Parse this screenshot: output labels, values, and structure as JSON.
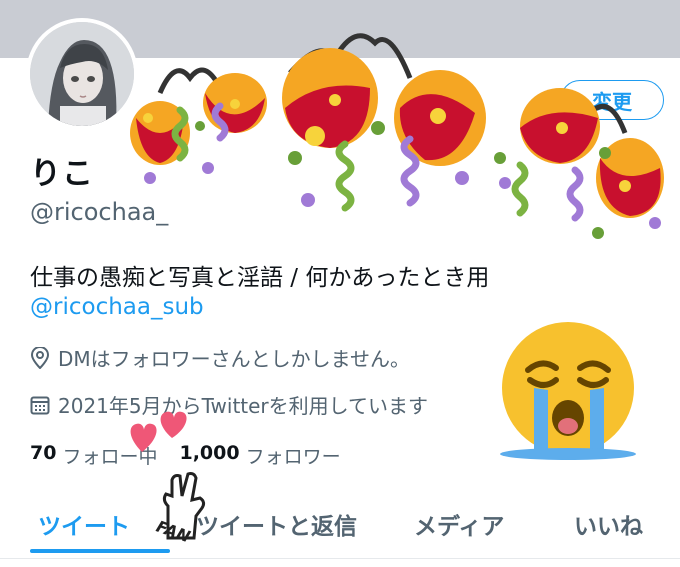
{
  "profile": {
    "display_name": "りこ",
    "handle": "@ricochaa_",
    "bio": "仕事の愚痴と写真と淫語 / 何かあったとき用",
    "bio_link": "@ricochaa_sub",
    "location": "DMはフォロワーさんとしかしません。",
    "joined": "2021年5月からTwitterを利用しています",
    "edit_button_label": "変更"
  },
  "stats": {
    "following_count": "70",
    "following_label": "フォロー中",
    "followers_count": "1,000",
    "followers_label": "フォロワー"
  },
  "tabs": [
    {
      "label": "ツイート",
      "active": true
    },
    {
      "label": "ツイートと返信",
      "active": false
    },
    {
      "label": "メディア",
      "active": false
    },
    {
      "label": "いいね",
      "active": false
    }
  ],
  "stickers": {
    "fan_hand_text": "FAN"
  },
  "colors": {
    "accent": "#1d9bf0",
    "muted_text": "#536471",
    "banner": "#c9ccd3"
  },
  "icons": [
    "location-pin-icon",
    "calendar-icon",
    "party-popper-sticker",
    "crying-face-sticker",
    "hearts-sticker",
    "fan-hand-sticker"
  ]
}
